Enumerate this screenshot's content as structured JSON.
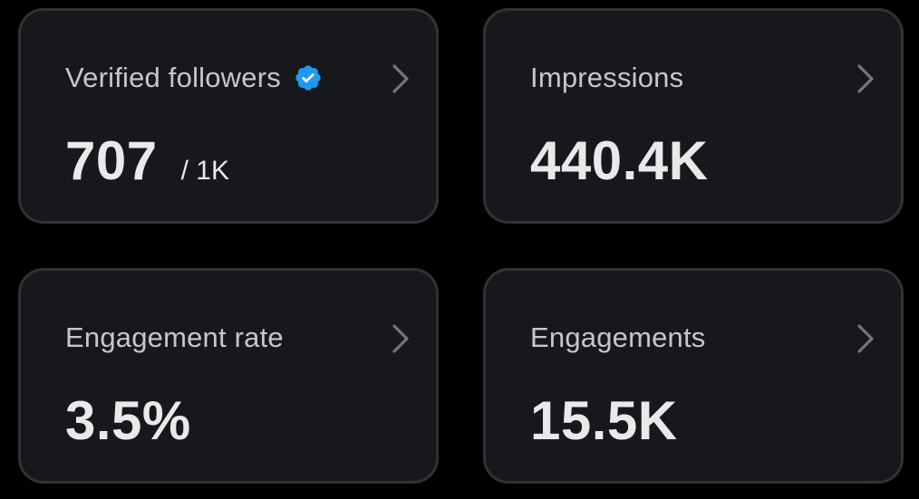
{
  "colors": {
    "page_background": "#000000",
    "card_background": "#16181c",
    "card_border": "#2f3336",
    "label_text": "#c4c7cc",
    "value_text": "#e7e9ea",
    "verified_badge": "#1d9bf0",
    "chevron": "#71767b"
  },
  "cards": [
    {
      "label": "Verified followers",
      "value": "707",
      "sub": "/ 1K",
      "icon": "verified-badge-icon"
    },
    {
      "label": "Impressions",
      "value": "440.4K"
    },
    {
      "label": "Engagement rate",
      "value": "3.5%"
    },
    {
      "label": "Engagements",
      "value": "15.5K"
    }
  ]
}
